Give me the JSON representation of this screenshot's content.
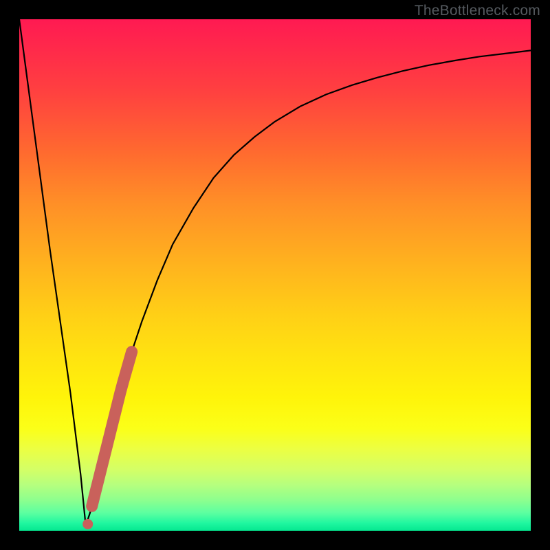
{
  "watermark": "TheBottleneck.com",
  "colors": {
    "frame": "#000000",
    "curve": "#000000",
    "marker_fill": "#c9615b",
    "marker_stroke": "#c9615b"
  },
  "chart_data": {
    "type": "line",
    "title": "",
    "xlabel": "",
    "ylabel": "",
    "xlim": [
      0,
      100
    ],
    "ylim": [
      0,
      100
    ],
    "grid": false,
    "legend": false,
    "description": "Bottleneck percentage curve: a sharp V near x≈13 (min≈0) with a steep left wall from 100 at x=0 and a saturating right branch approaching ≈94 as x→100. Highlighted marker segment along the rising right branch roughly x∈[14,22].",
    "series": [
      {
        "name": "bottleneck_curve",
        "x": [
          0,
          2,
          4,
          6,
          8,
          10,
          12,
          13,
          14,
          16,
          18,
          20,
          22,
          24,
          27,
          30,
          34,
          38,
          42,
          46,
          50,
          55,
          60,
          65,
          70,
          75,
          80,
          85,
          90,
          95,
          100
        ],
        "y": [
          100,
          85,
          70,
          55,
          41,
          27,
          11,
          1,
          4,
          12,
          20,
          28,
          35,
          41,
          49,
          56,
          63,
          69,
          73.5,
          77,
          80,
          83,
          85.3,
          87.1,
          88.6,
          89.9,
          91,
          91.9,
          92.7,
          93.3,
          93.9
        ]
      }
    ],
    "highlight": {
      "description": "Pink rounded marker segment on right branch plus a small dot near the minimum",
      "segment_x": [
        14.2,
        22.0
      ],
      "segment_y": [
        4.5,
        35.0
      ],
      "dot": {
        "x": 13.4,
        "y": 1.3
      }
    }
  }
}
